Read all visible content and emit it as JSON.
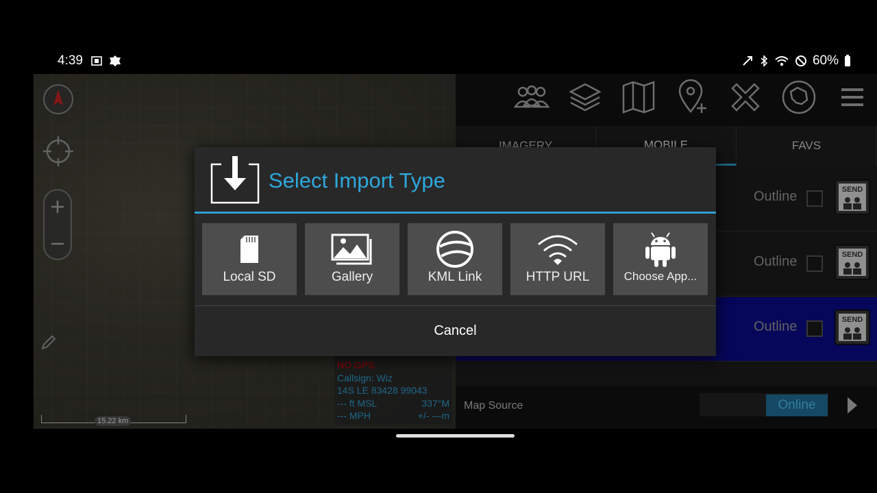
{
  "status_bar": {
    "time": "4:39",
    "battery": "60%"
  },
  "map": {
    "scale_label": "15.22 km",
    "gps": {
      "status": "NO GPS",
      "callsign": "Callsign: Wiz",
      "grid": "14S  LE  83428  99043",
      "altitude": "--- ft MSL",
      "heading": "337°M",
      "speed": "--- MPH",
      "accuracy": "+/- ---m"
    }
  },
  "panel": {
    "tabs": [
      {
        "label": "IMAGERY"
      },
      {
        "label": "MOBILE"
      },
      {
        "label": "FAVS"
      }
    ],
    "rows": [
      {
        "outline_label": "Outline",
        "send_label": "SEND"
      },
      {
        "outline_label": "Outline",
        "send_label": "SEND"
      },
      {
        "outline_label": "Outline",
        "send_label": "SEND"
      }
    ],
    "footer": {
      "map_source_label": "Map Source",
      "online_label": "Online"
    }
  },
  "dialog": {
    "title": "Select Import Type",
    "options": [
      {
        "label": "Local SD",
        "icon": "sd-card-icon"
      },
      {
        "label": "Gallery",
        "icon": "gallery-icon"
      },
      {
        "label": "KML Link",
        "icon": "globe-icon"
      },
      {
        "label": "HTTP URL",
        "icon": "wifi-icon"
      },
      {
        "label": "Choose App...",
        "icon": "android-icon"
      }
    ],
    "cancel_label": "Cancel"
  },
  "colors": {
    "accent": "#2ea8dc",
    "selected_row": "#0a0a8a",
    "gps_text": "#2e9fd1",
    "no_gps": "#dd0000"
  }
}
